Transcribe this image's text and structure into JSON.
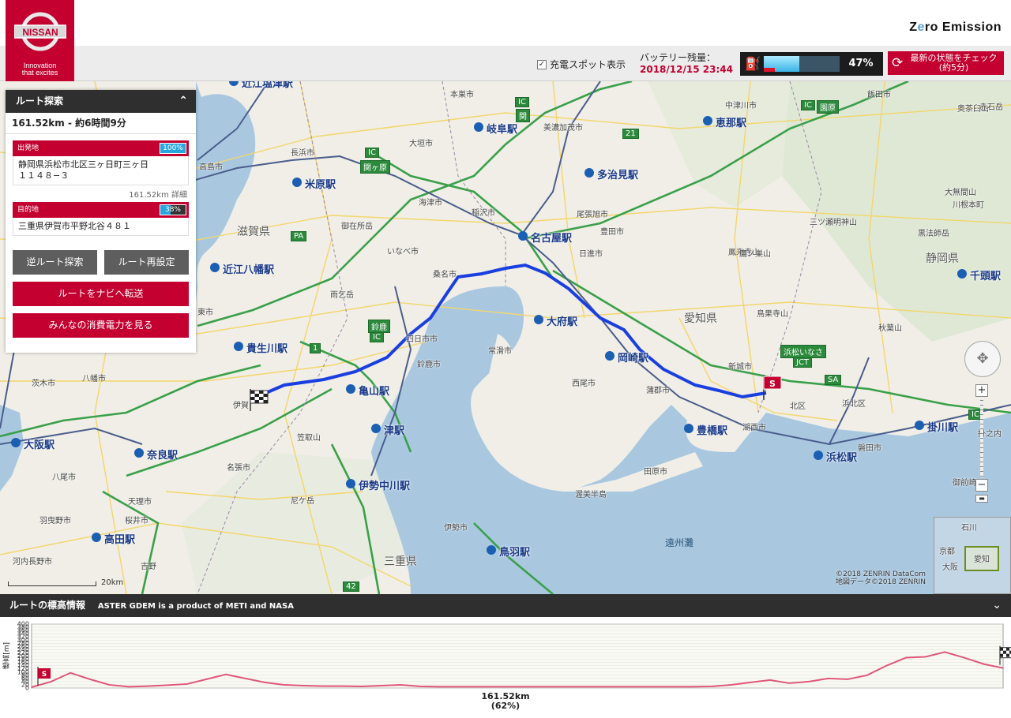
{
  "header": {
    "logo_text": "NISSAN",
    "tagline_1": "Innovation",
    "tagline_2": "that excites",
    "brand_prefix": "Z",
    "brand_o": "e",
    "brand_rest": "ro Emission"
  },
  "status": {
    "spot_label": "充電スポット表示",
    "spot_checked": true,
    "battery_label": "バッテリー残量：",
    "battery_datetime": "2018/12/15 23:44",
    "battery_percent_text": "47%",
    "battery_level": 0.47,
    "refresh_line1": "最新の状態をチェック",
    "refresh_line2": "(約5分)"
  },
  "route_panel": {
    "title": "ルート探索",
    "summary": "161.52km - 約6時間9分",
    "origin": {
      "label": "出発地",
      "percent_text": "100%",
      "percent": 100,
      "address_line1": "静岡県浜松市北区三ヶ日町三ヶ日",
      "address_line2": "１１４８−３",
      "distance": "161.52km",
      "detail_link": "詳細"
    },
    "destination": {
      "label": "目的地",
      "percent_text": "38%",
      "percent": 38,
      "address": "三重県伊賀市平野北谷４８１"
    },
    "buttons": {
      "reverse": "逆ルート探索",
      "reset": "ルート再設定",
      "send_nav": "ルートをナビへ転送",
      "consumption": "みんなの消費電力を見る"
    }
  },
  "map": {
    "labels": [
      {
        "text": "近江塩津駅",
        "kind": "stn"
      },
      {
        "text": "本巣市",
        "kind": "sm"
      },
      {
        "text": "岐阜駅",
        "kind": "stn"
      },
      {
        "text": "美濃加茂市",
        "kind": "sm"
      },
      {
        "text": "中津川市",
        "kind": "sm"
      },
      {
        "text": "恵那駅",
        "kind": "stn"
      },
      {
        "text": "飯田市",
        "kind": "sm"
      },
      {
        "text": "奥茶臼山",
        "kind": "sm"
      },
      {
        "text": "赤石岳",
        "kind": "sm"
      },
      {
        "text": "長浜市",
        "kind": "sm"
      },
      {
        "text": "高島市",
        "kind": "sm"
      },
      {
        "text": "米原駅",
        "kind": "stn"
      },
      {
        "text": "大垣市",
        "kind": "sm"
      },
      {
        "text": "多治見駅",
        "kind": "stn"
      },
      {
        "text": "海津市",
        "kind": "sm"
      },
      {
        "text": "稲沢市",
        "kind": "sm"
      },
      {
        "text": "尾張旭市",
        "kind": "sm"
      },
      {
        "text": "豊田市",
        "kind": "sm"
      },
      {
        "text": "三ツ瀬明神山",
        "kind": "sm"
      },
      {
        "text": "大無間山",
        "kind": "sm"
      },
      {
        "text": "川根本町",
        "kind": "sm"
      },
      {
        "text": "御在所岳",
        "kind": "sm"
      },
      {
        "text": "滋賀県",
        "kind": "big"
      },
      {
        "text": "名古屋駅",
        "kind": "stn"
      },
      {
        "text": "鳳来寺山",
        "kind": "sm"
      },
      {
        "text": "黒法師岳",
        "kind": "sm"
      },
      {
        "text": "いなべ市",
        "kind": "sm"
      },
      {
        "text": "日進市",
        "kind": "sm"
      },
      {
        "text": "鷹ノ巣山",
        "kind": "sm"
      },
      {
        "text": "静岡県",
        "kind": "big"
      },
      {
        "text": "近江八幡駅",
        "kind": "stn"
      },
      {
        "text": "千頭駅",
        "kind": "stn"
      },
      {
        "text": "桑名市",
        "kind": "sm"
      },
      {
        "text": "雨乞岳",
        "kind": "sm"
      },
      {
        "text": "大府駅",
        "kind": "stn"
      },
      {
        "text": "愛知県",
        "kind": "big"
      },
      {
        "text": "鳥果寺山",
        "kind": "sm"
      },
      {
        "text": "秋葉山",
        "kind": "sm"
      },
      {
        "text": "東市",
        "kind": "sm"
      },
      {
        "text": "四日市市",
        "kind": "sm"
      },
      {
        "text": "常滑市",
        "kind": "sm"
      },
      {
        "text": "貴生川駅",
        "kind": "stn"
      },
      {
        "text": "岡崎駅",
        "kind": "stn"
      },
      {
        "text": "新城市",
        "kind": "sm"
      },
      {
        "text": "茨木市",
        "kind": "sm"
      },
      {
        "text": "八幡市",
        "kind": "sm"
      },
      {
        "text": "鈴鹿市",
        "kind": "sm"
      },
      {
        "text": "亀山駅",
        "kind": "stn"
      },
      {
        "text": "西尾市",
        "kind": "sm"
      },
      {
        "text": "蒲郡市",
        "kind": "sm"
      },
      {
        "text": "北区",
        "kind": "sm"
      },
      {
        "text": "浜北区",
        "kind": "sm"
      },
      {
        "text": "伊賀",
        "kind": "sm"
      },
      {
        "text": "豊橋駅",
        "kind": "stn"
      },
      {
        "text": "掛川駅",
        "kind": "stn"
      },
      {
        "text": "大阪駅",
        "kind": "stn"
      },
      {
        "text": "津駅",
        "kind": "stn"
      },
      {
        "text": "湖西市",
        "kind": "sm"
      },
      {
        "text": "浜松駅",
        "kind": "stn"
      },
      {
        "text": "磐田市",
        "kind": "sm"
      },
      {
        "text": "笠取山",
        "kind": "sm"
      },
      {
        "text": "奈良駅",
        "kind": "stn"
      },
      {
        "text": "八尾市",
        "kind": "sm"
      },
      {
        "text": "名張市",
        "kind": "sm"
      },
      {
        "text": "田原市",
        "kind": "sm"
      },
      {
        "text": "天理市",
        "kind": "sm"
      },
      {
        "text": "伊勢中川駅",
        "kind": "stn"
      },
      {
        "text": "渥美半島",
        "kind": "sm"
      },
      {
        "text": "御前崎",
        "kind": "sm"
      },
      {
        "text": "尼ケ岳",
        "kind": "sm"
      },
      {
        "text": "羽曳野市",
        "kind": "sm"
      },
      {
        "text": "桜井市",
        "kind": "sm"
      },
      {
        "text": "伊勢市",
        "kind": "sm"
      },
      {
        "text": "鳥羽駅",
        "kind": "stn"
      },
      {
        "text": "高田駅",
        "kind": "stn"
      },
      {
        "text": "遠州灘",
        "kind": "sea"
      },
      {
        "text": "河内長野市",
        "kind": "sm"
      },
      {
        "text": "三重県",
        "kind": "big"
      },
      {
        "text": "吉野",
        "kind": "sm"
      },
      {
        "text": "掛之内",
        "kind": "sm"
      }
    ],
    "ic_labels": [
      "IC",
      "関",
      "IC",
      "関ヶ原",
      "21",
      "IC",
      "園原",
      "PA",
      "鈴鹿",
      "IC",
      "1",
      "浜松いなさ",
      "JCT",
      "SA",
      "IC",
      "42"
    ],
    "copyright_1": "©2018 ZENRIN DataCom",
    "copyright_2": "地図データ©2018 ZENRIN",
    "scale_label": "20km",
    "minimap_labels": [
      "石川",
      "京都",
      "愛知",
      "大阪"
    ],
    "start_flag_letter": "S"
  },
  "elevation": {
    "title": "ルートの標高情報",
    "subtitle": "ASTER GDEM is a product of METI and NASA",
    "ylabel": "標高[m]",
    "x_distance": "161.52km",
    "x_percent": "(62%)",
    "start_flag_letter": "S"
  },
  "chart_data": {
    "type": "area",
    "title": "",
    "xlabel": "",
    "ylabel": "標高[m]",
    "ylim": [
      0,
      400
    ],
    "yticks": [
      0,
      20,
      40,
      60,
      80,
      100,
      120,
      140,
      160,
      180,
      200,
      220,
      240,
      260,
      280,
      300,
      320,
      340,
      360,
      380,
      400
    ],
    "x": [
      0,
      2,
      4,
      6,
      8,
      10,
      12,
      14,
      16,
      18,
      20,
      22,
      24,
      26,
      28,
      30,
      32,
      34,
      36,
      38,
      40,
      42,
      44,
      46,
      48,
      50,
      52,
      54,
      56,
      58,
      60,
      62,
      64,
      66,
      68,
      70,
      72,
      74,
      76,
      78,
      80,
      82,
      84,
      86,
      88,
      90,
      92,
      94,
      96,
      98,
      100
    ],
    "series": [
      {
        "values": [
          5,
          40,
          95,
          55,
          20,
          8,
          12,
          18,
          25,
          55,
          85,
          60,
          35,
          20,
          15,
          12,
          12,
          10,
          15,
          20,
          10,
          8,
          8,
          8,
          8,
          8,
          8,
          8,
          8,
          8,
          8,
          8,
          8,
          8,
          8,
          10,
          20,
          35,
          50,
          30,
          40,
          60,
          55,
          80,
          140,
          190,
          195,
          225,
          190,
          150,
          125
        ]
      }
    ],
    "grid": true
  }
}
